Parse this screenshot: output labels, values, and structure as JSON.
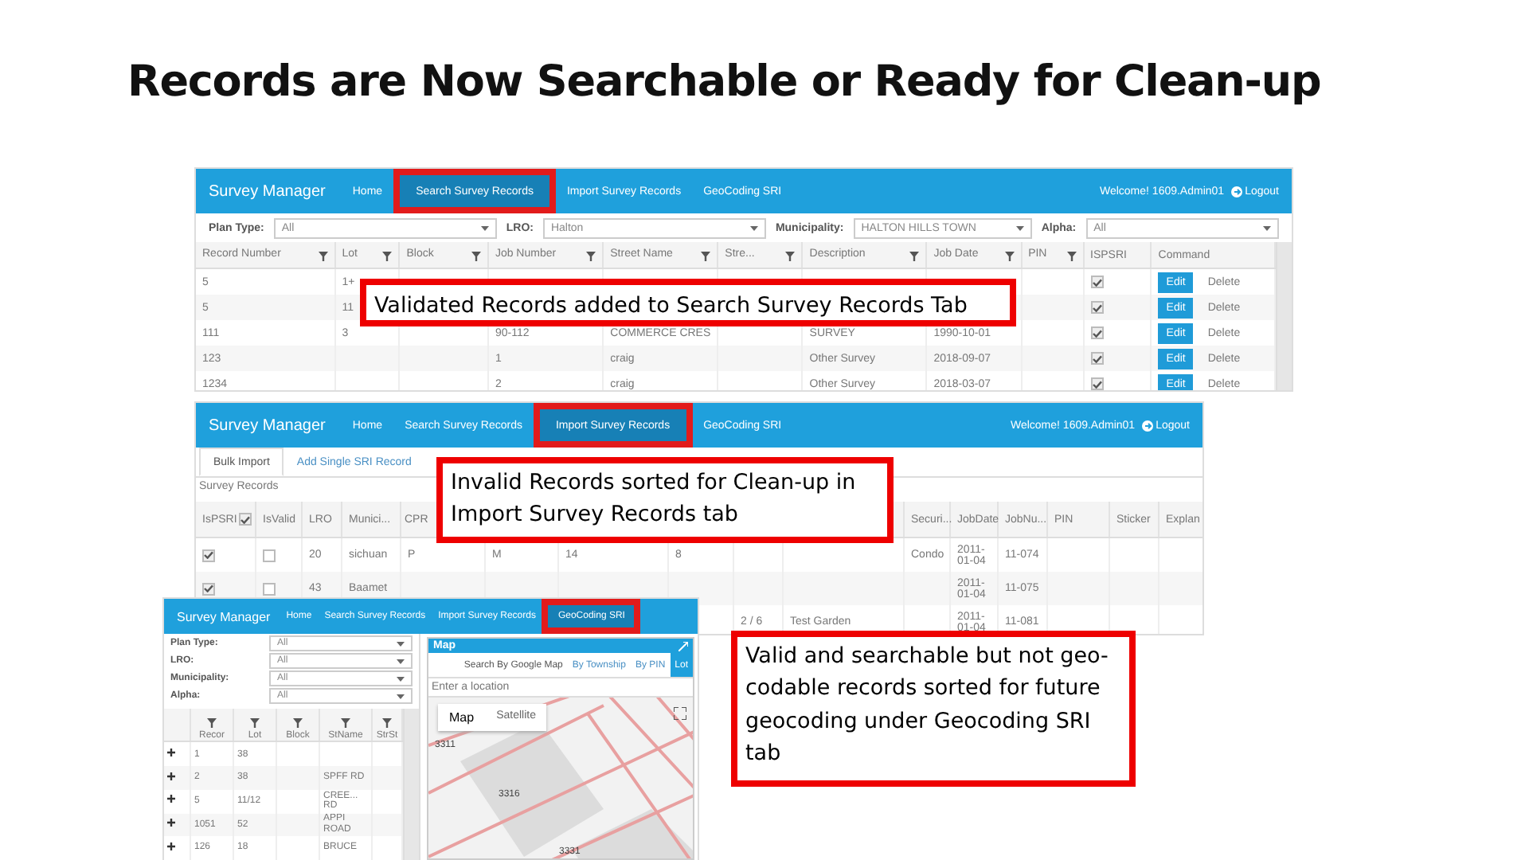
{
  "title": "Records are Now Searchable or Ready for Clean-up",
  "screenshots": [
    {
      "kind": "search",
      "navbar": {
        "brand": "Survey Manager",
        "items": [
          {
            "label": "Home",
            "selected": false
          },
          {
            "label": "Search Survey Records",
            "selected": true
          },
          {
            "label": "Import Survey Records",
            "selected": false
          },
          {
            "label": "GeoCoding SRI",
            "selected": false
          }
        ],
        "welcome": "Welcome! 1609.Admin01",
        "logout": "Logout"
      },
      "filters": [
        {
          "label": "Plan Type:",
          "value": "All"
        },
        {
          "label": "LRO:",
          "value": "Halton"
        },
        {
          "label": "Municipality:",
          "value": "HALTON HILLS TOWN"
        },
        {
          "label": "Alpha:",
          "value": "All"
        }
      ],
      "table": {
        "columns": [
          {
            "label": "Record Number",
            "filterable": true
          },
          {
            "label": "Lot",
            "filterable": true
          },
          {
            "label": "Block",
            "filterable": true
          },
          {
            "label": "Job Number",
            "filterable": true
          },
          {
            "label": "Street Name",
            "filterable": true
          },
          {
            "label": "Stre...",
            "filterable": true
          },
          {
            "label": "Description",
            "filterable": true
          },
          {
            "label": "Job Date",
            "filterable": true
          },
          {
            "label": "PIN",
            "filterable": true
          },
          {
            "label": "ISPSRI",
            "filterable": false
          },
          {
            "label": "Command",
            "filterable": false
          }
        ],
        "rows": [
          {
            "cells": [
              "5",
              "1+",
              "",
              "",
              "",
              "",
              "",
              "",
              ""
            ],
            "checked": true,
            "actions": [
              "Edit",
              "Delete"
            ]
          },
          {
            "cells": [
              "5",
              "11",
              "",
              "",
              "",
              "",
              "",
              "",
              ""
            ],
            "checked": true,
            "actions": [
              "Edit",
              "Delete"
            ]
          },
          {
            "cells": [
              "111",
              "3",
              "",
              "90-112",
              "COMMERCE CRES",
              "",
              "SURVEY",
              "1990-10-01",
              ""
            ],
            "checked": true,
            "actions": [
              "Edit",
              "Delete"
            ]
          },
          {
            "cells": [
              "123",
              "",
              "",
              "1",
              "craig",
              "",
              "Other Survey",
              "2018-09-07",
              ""
            ],
            "checked": true,
            "actions": [
              "Edit",
              "Delete"
            ]
          },
          {
            "cells": [
              "1234",
              "",
              "",
              "2",
              "craig",
              "",
              "Other Survey",
              "2018-03-07",
              ""
            ],
            "checked": true,
            "actions": [
              "Edit",
              "Delete"
            ]
          }
        ]
      }
    },
    {
      "kind": "import",
      "navbar": {
        "brand": "Survey Manager",
        "items": [
          {
            "label": "Home",
            "selected": false
          },
          {
            "label": "Search Survey Records",
            "selected": false
          },
          {
            "label": "Import Survey Records",
            "selected": true
          },
          {
            "label": "GeoCoding SRI",
            "selected": false
          }
        ],
        "welcome": "Welcome! 1609.Admin01",
        "logout": "Logout"
      },
      "subtabs": [
        {
          "label": "Bulk Import",
          "selected": true
        },
        {
          "label": "Add Single SRI Record",
          "selected": false
        }
      ],
      "section": "Survey Records",
      "table": {
        "header_checked": true,
        "columns": [
          "IsPSRI",
          "IsValid",
          "LRO",
          "Munici...",
          "CPR",
          "",
          "",
          "",
          "",
          "",
          "Securi...",
          "JobDate",
          "JobNu...",
          "PIN",
          "Sticker",
          "Explan"
        ],
        "rows": [
          {
            "cells": [
              {
                "checked": true
              },
              {
                "checked": false
              },
              "20",
              "sichuan",
              "P",
              "M",
              "14",
              "8",
              "",
              "",
              "Condo",
              "2011-01-04",
              "11-074",
              "",
              "",
              ""
            ]
          },
          {
            "cells": [
              {
                "checked": true
              },
              {
                "checked": false
              },
              "43",
              "Baamet",
              "",
              "",
              "",
              "",
              "",
              "",
              "",
              "2011-01-04",
              "11-075",
              "",
              "",
              ""
            ]
          },
          {
            "cells": [
              "",
              "",
              "",
              "",
              "",
              "",
              "",
              "",
              "2 / 6",
              "Test Garden",
              "",
              "2011-01-04",
              "11-081",
              "",
              "",
              ""
            ]
          }
        ]
      }
    },
    {
      "kind": "geocode",
      "navbar": {
        "brand": "Survey Manager",
        "items": [
          {
            "label": "Home",
            "selected": false
          },
          {
            "label": "Search Survey Records",
            "selected": false
          },
          {
            "label": "Import Survey Records",
            "selected": false
          },
          {
            "label": "GeoCoding SRI",
            "selected": true
          }
        ]
      },
      "filters": [
        {
          "label": "Plan Type:",
          "value": "All"
        },
        {
          "label": "LRO:",
          "value": "All"
        },
        {
          "label": "Municipality:",
          "value": "All"
        },
        {
          "label": "Alpha:",
          "value": "All"
        }
      ],
      "table": {
        "columns": [
          "Recor",
          "Lot",
          "Block",
          "StName",
          "StrSt"
        ],
        "rows": [
          [
            "1",
            "38",
            "",
            "",
            ""
          ],
          [
            "2",
            "38",
            "",
            "SPFF RD",
            ""
          ],
          [
            "5",
            "11/12",
            "",
            "CREE... RD",
            ""
          ],
          [
            "1051",
            "52",
            "",
            "APPI ROAD",
            ""
          ],
          [
            "126",
            "18",
            "",
            "BRUCE",
            ""
          ]
        ]
      },
      "map": {
        "title": "Map",
        "tabs": [
          {
            "label": "Search By Google Map",
            "selected": false
          },
          {
            "label": "By Township",
            "selected": false
          },
          {
            "label": "By PIN",
            "selected": false
          },
          {
            "label": "Lot",
            "selected": true
          }
        ],
        "placeholder": "Enter a location",
        "views": [
          {
            "label": "Map",
            "selected": true
          },
          {
            "label": "Satellite",
            "selected": false
          }
        ],
        "labels": [
          "3311",
          "3316",
          "3331"
        ]
      }
    }
  ],
  "callouts": [
    {
      "text": "Validated Records added to Search Survey Records Tab"
    },
    {
      "text": "Invalid Records sorted for Clean-up in Import Survey Records tab"
    },
    {
      "text": "Valid and searchable but not geo-codable records sorted for future geocoding under Geocoding SRI tab"
    }
  ]
}
